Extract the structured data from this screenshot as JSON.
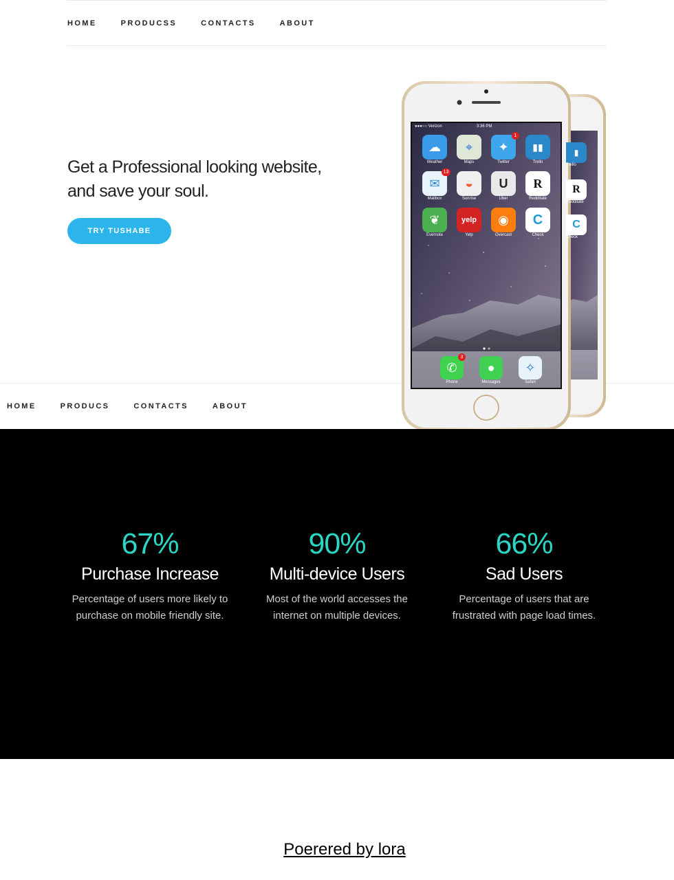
{
  "top_nav": {
    "items": [
      "HOME",
      "PRODUCSS",
      "CONTACTS",
      "ABOUT"
    ]
  },
  "hero": {
    "title_line1": "Get a Professional looking website,",
    "title_line2": "and save your soul.",
    "cta_label": "TRY TUSHABE"
  },
  "phone": {
    "carrier": "●●●○○ Verizon",
    "time": "3:36 PM",
    "apps": [
      {
        "label": "Weather",
        "color": "#3a9be8",
        "glyph": "☁",
        "badge": ""
      },
      {
        "label": "Maps",
        "color": "#dfe8d6",
        "glyph": "⌖",
        "badge": ""
      },
      {
        "label": "Twitter",
        "color": "#3da6ec",
        "glyph": "✦",
        "badge": "1"
      },
      {
        "label": "Trello",
        "color": "#2a87c9",
        "glyph": "▮▮",
        "badge": ""
      },
      {
        "label": "Mailbox",
        "color": "#e8f3fb",
        "glyph": "✉",
        "badge": "13"
      },
      {
        "label": "Sunrise",
        "color": "#f0f0f0",
        "glyph": "◒",
        "badge": ""
      },
      {
        "label": "Uber",
        "color": "#e9e9e9",
        "glyph": "U",
        "badge": ""
      },
      {
        "label": "Redditate",
        "color": "#ffffff",
        "glyph": "R",
        "badge": ""
      },
      {
        "label": "Evernote",
        "color": "#4caf50",
        "glyph": "❦",
        "badge": ""
      },
      {
        "label": "Yelp",
        "color": "#d32323",
        "glyph": "yelp",
        "badge": ""
      },
      {
        "label": "Overcast",
        "color": "#fc7e0f",
        "glyph": "◉",
        "badge": ""
      },
      {
        "label": "Check",
        "color": "#ffffff",
        "glyph": "C",
        "badge": ""
      }
    ],
    "dock": [
      {
        "label": "Phone",
        "color": "#3ed24f",
        "glyph": "✆",
        "badge": "3"
      },
      {
        "label": "Messages",
        "color": "#41d152",
        "glyph": "●",
        "badge": ""
      },
      {
        "label": "Safari",
        "color": "#e8f2fb",
        "glyph": "✧",
        "badge": ""
      }
    ],
    "back_apps": [
      {
        "label": "Trello",
        "glyph": "▮"
      },
      {
        "label": "Redditate",
        "glyph": "R"
      },
      {
        "label": "Check",
        "glyph": "C"
      }
    ]
  },
  "sticky_nav": {
    "items": [
      "HOME",
      "PRODUCS",
      "CONTACTS",
      "ABOUT"
    ]
  },
  "stats": [
    {
      "value": "67%",
      "title": "Purchase Increase",
      "desc_line1": "Percentage of users more likely to",
      "desc_line2": "purchase on mobile friendly site."
    },
    {
      "value": "90%",
      "title": "Multi-device Users",
      "desc_line1": "Most of the world accesses the",
      "desc_line2": "internet on multiple devices."
    },
    {
      "value": "66%",
      "title": "Sad Users",
      "desc_line1": "Percentage of users that are",
      "desc_line2": "frustrated with page load times."
    }
  ],
  "footer": {
    "link_text": "Poerered by lora"
  },
  "colors": {
    "accent": "#2bb5eb",
    "stat": "#2ad6c4",
    "stats_bg": "#000000"
  }
}
